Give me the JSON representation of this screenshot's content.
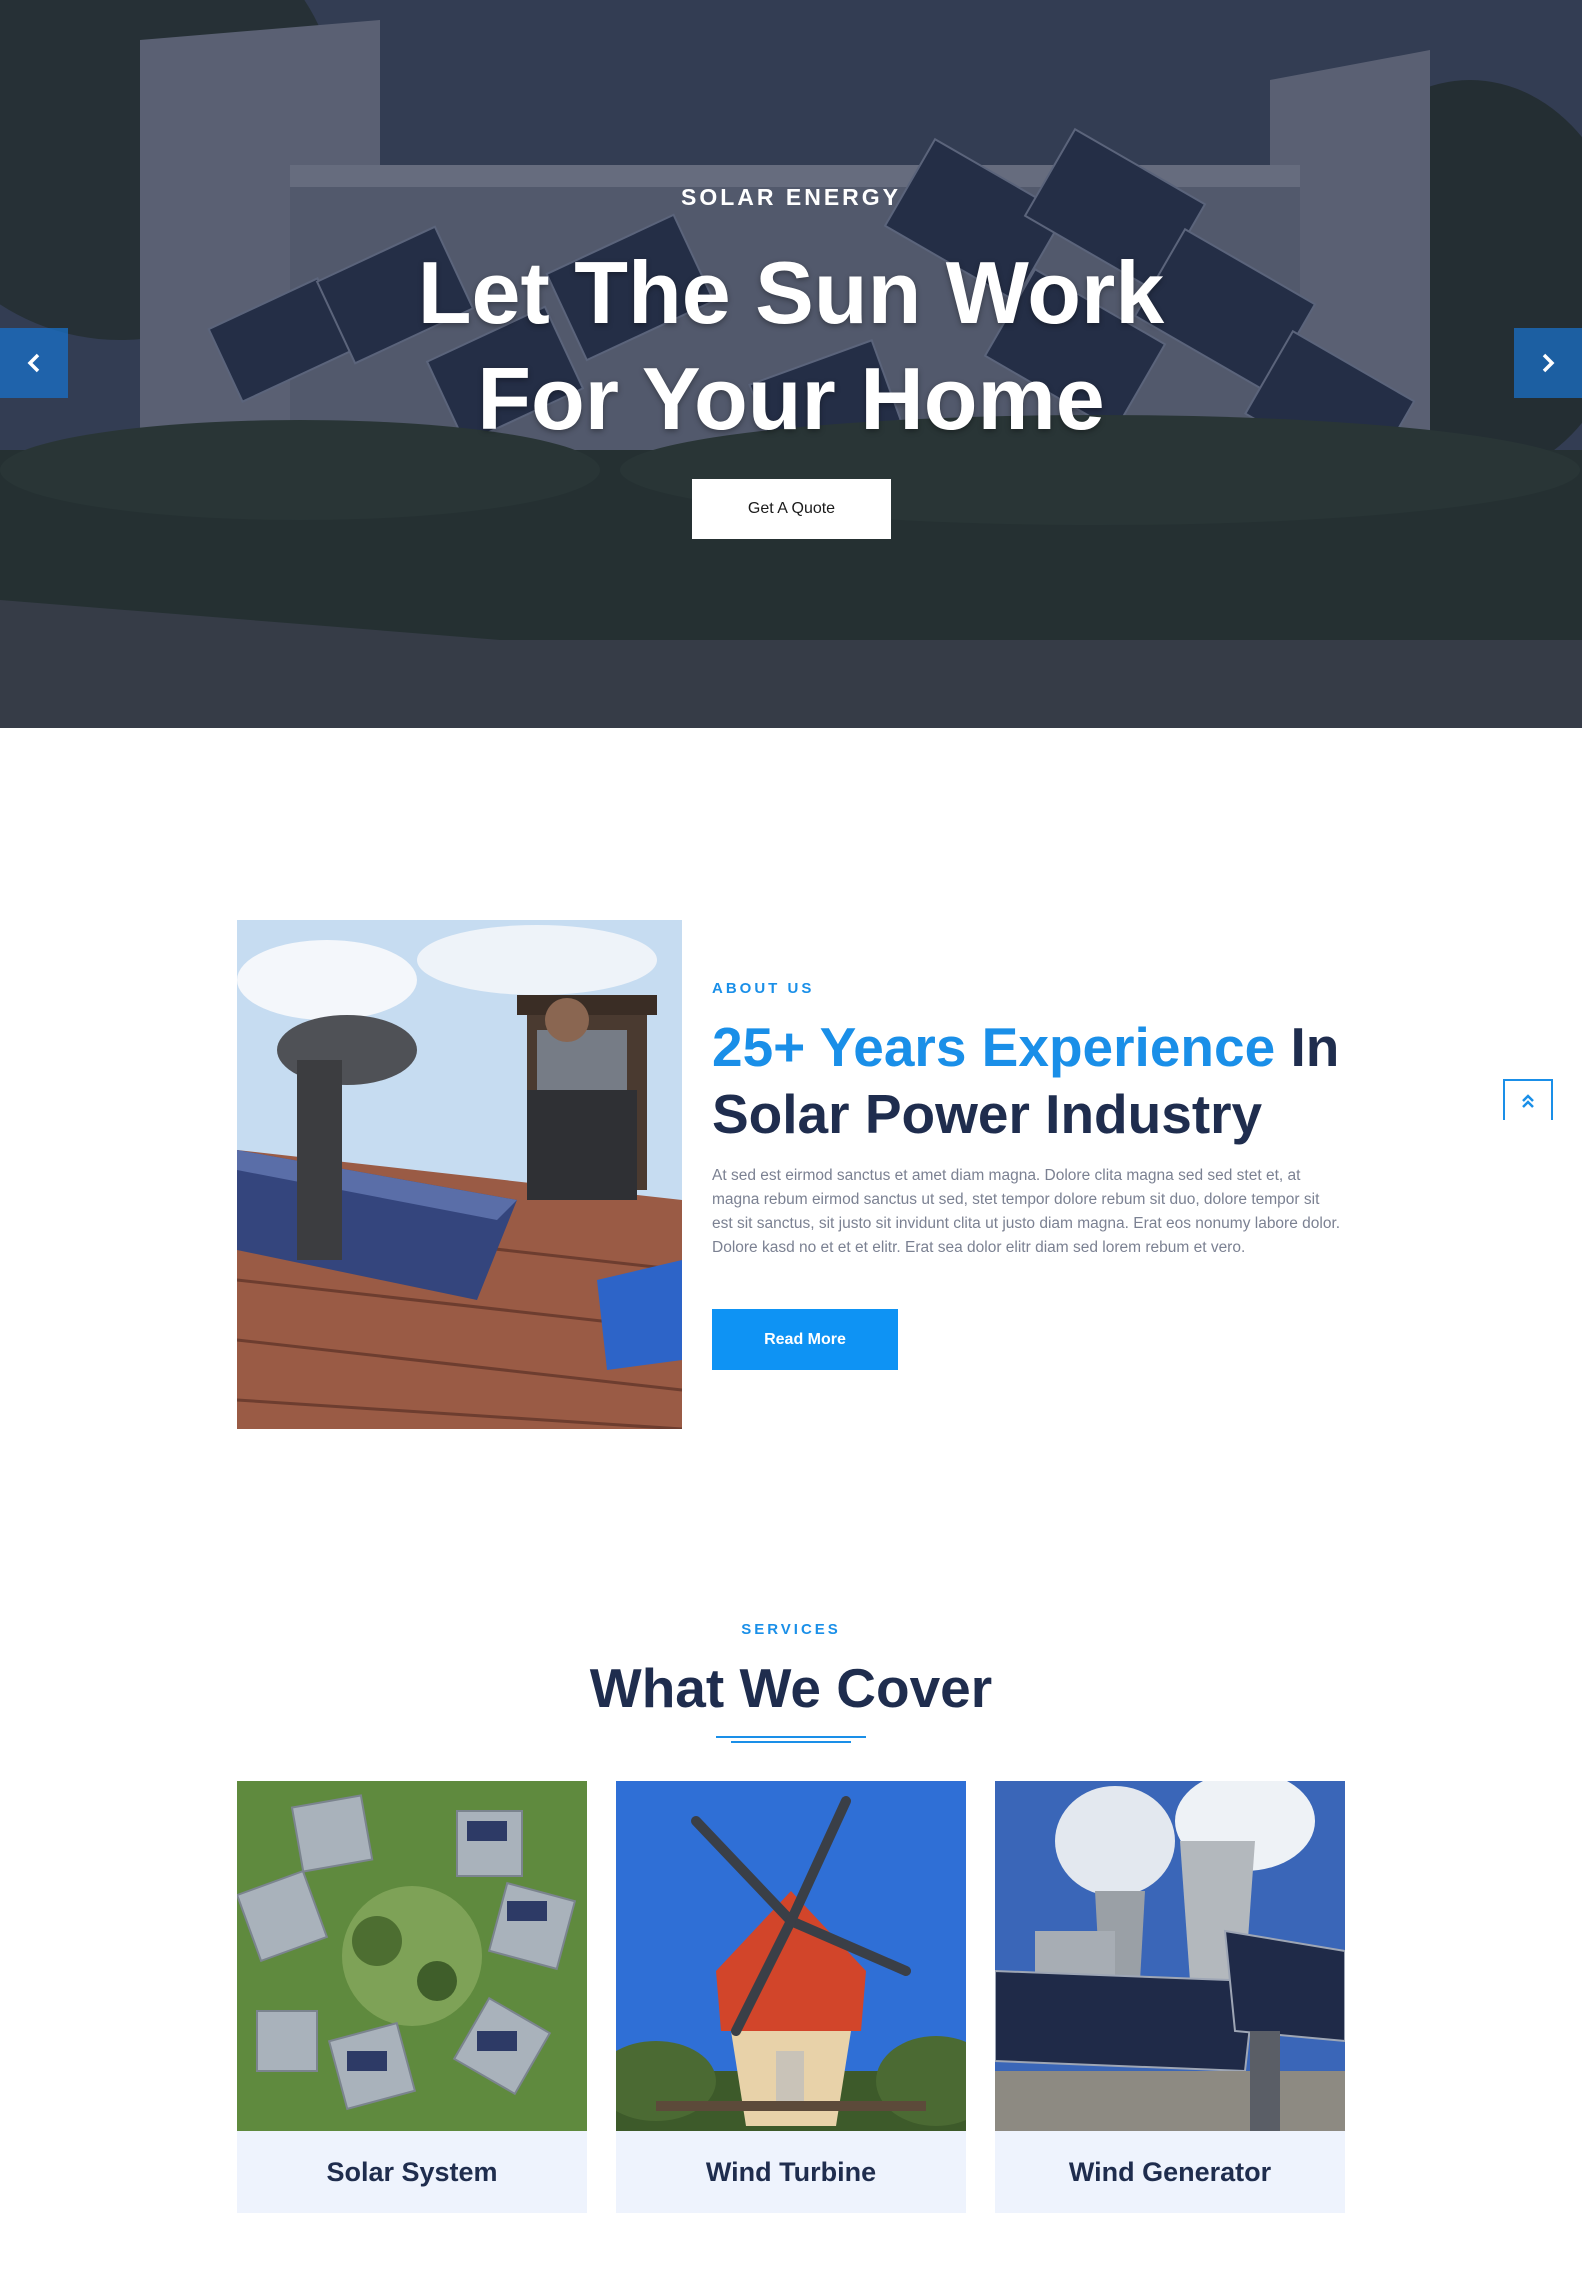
{
  "hero": {
    "kicker": "SOLAR ENERGY",
    "title": "Let The Sun Work For Your Home",
    "cta_label": "Get A Quote",
    "prev_icon": "chevron-left-icon",
    "next_icon": "chevron-right-icon"
  },
  "about": {
    "kicker": "ABOUT US",
    "title_accent": "25+ Years Experience",
    "title_rest": " In Solar Power Industry",
    "body": "At sed est eirmod sanctus et amet diam magna. Dolore clita magna sed sed stet et, at magna rebum eirmod sanctus ut sed, stet tempor dolore rebum sit duo, dolore tempor sit est sit sanctus, sit justo sit invidunt clita ut justo diam magna. Erat eos nonumy labore dolor. Dolore kasd no et et et elitr. Erat sea dolor elitr diam sed lorem rebum et vero.",
    "button_label": "Read More"
  },
  "back_to_top": {
    "icon": "double-chevron-up-icon"
  },
  "services": {
    "kicker": "SERVICES",
    "title": "What We Cover",
    "items": [
      {
        "label": "Solar System"
      },
      {
        "label": "Wind Turbine"
      },
      {
        "label": "Wind Generator"
      }
    ]
  },
  "colors": {
    "accent": "#1a8fe8",
    "button_blue": "#0e93f4",
    "heading_navy": "#1f2d4e",
    "card_bg": "#eef3fd"
  }
}
